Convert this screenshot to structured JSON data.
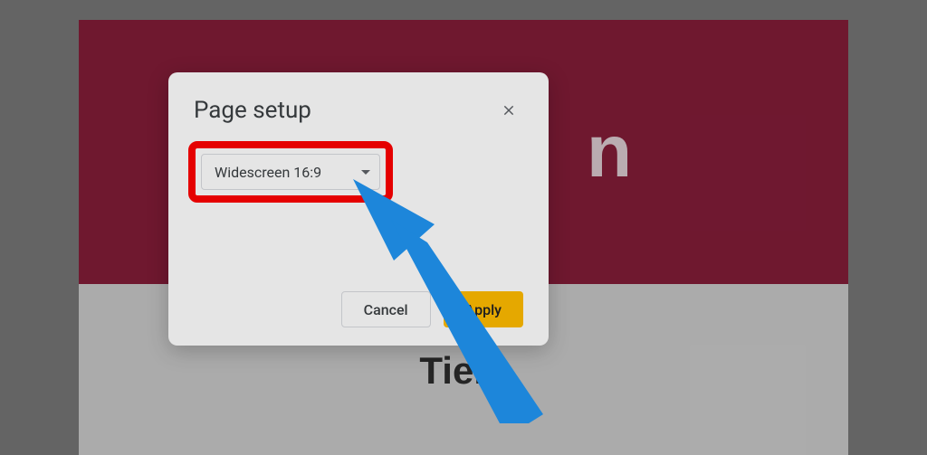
{
  "background": {
    "banner_text": "n",
    "below_text": "Tien."
  },
  "dialog": {
    "title": "Page setup",
    "dropdown_value": "Widescreen 16:9",
    "cancel_label": "Cancel",
    "apply_label": "Apply"
  }
}
